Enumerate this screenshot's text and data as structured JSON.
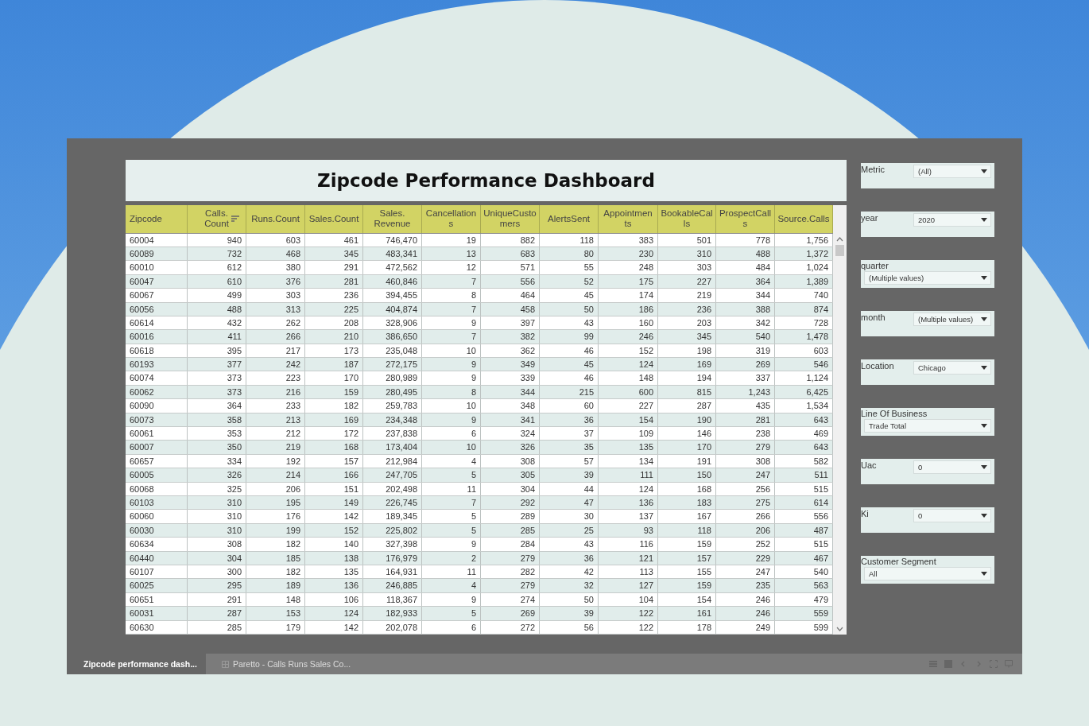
{
  "dashboard": {
    "title": "Zipcode Performance Dashboard"
  },
  "table": {
    "columns": [
      {
        "label_lines": [
          "Zipcode"
        ],
        "kind": "text",
        "sorted": false
      },
      {
        "label_lines": [
          "Calls.",
          "Count"
        ],
        "kind": "number",
        "sorted": true
      },
      {
        "label_lines": [
          "Runs.Count"
        ],
        "kind": "number",
        "sorted": false
      },
      {
        "label_lines": [
          "Sales.Count"
        ],
        "kind": "number",
        "sorted": false
      },
      {
        "label_lines": [
          "Sales.",
          "Revenue"
        ],
        "kind": "number",
        "sorted": false
      },
      {
        "label_lines": [
          "Cancellation",
          "s"
        ],
        "kind": "number",
        "sorted": false
      },
      {
        "label_lines": [
          "UniqueCusto",
          "mers"
        ],
        "kind": "number",
        "sorted": false
      },
      {
        "label_lines": [
          "AlertsSent"
        ],
        "kind": "number",
        "sorted": false
      },
      {
        "label_lines": [
          "Appointmen",
          "ts"
        ],
        "kind": "number",
        "sorted": false
      },
      {
        "label_lines": [
          "BookableCal",
          "ls"
        ],
        "kind": "number",
        "sorted": false
      },
      {
        "label_lines": [
          "ProspectCall",
          "s"
        ],
        "kind": "number",
        "sorted": false
      },
      {
        "label_lines": [
          "Source.Calls"
        ],
        "kind": "number",
        "sorted": false
      }
    ],
    "rows": [
      [
        "60004",
        "940",
        "603",
        "461",
        "746,470",
        "19",
        "882",
        "118",
        "383",
        "501",
        "778",
        "1,756"
      ],
      [
        "60089",
        "732",
        "468",
        "345",
        "483,341",
        "13",
        "683",
        "80",
        "230",
        "310",
        "488",
        "1,372"
      ],
      [
        "60010",
        "612",
        "380",
        "291",
        "472,562",
        "12",
        "571",
        "55",
        "248",
        "303",
        "484",
        "1,024"
      ],
      [
        "60047",
        "610",
        "376",
        "281",
        "460,846",
        "7",
        "556",
        "52",
        "175",
        "227",
        "364",
        "1,389"
      ],
      [
        "60067",
        "499",
        "303",
        "236",
        "394,455",
        "8",
        "464",
        "45",
        "174",
        "219",
        "344",
        "740"
      ],
      [
        "60056",
        "488",
        "313",
        "225",
        "404,874",
        "7",
        "458",
        "50",
        "186",
        "236",
        "388",
        "874"
      ],
      [
        "60614",
        "432",
        "262",
        "208",
        "328,906",
        "9",
        "397",
        "43",
        "160",
        "203",
        "342",
        "728"
      ],
      [
        "60016",
        "411",
        "266",
        "210",
        "386,650",
        "7",
        "382",
        "99",
        "246",
        "345",
        "540",
        "1,478"
      ],
      [
        "60618",
        "395",
        "217",
        "173",
        "235,048",
        "10",
        "362",
        "46",
        "152",
        "198",
        "319",
        "603"
      ],
      [
        "60193",
        "377",
        "242",
        "187",
        "272,175",
        "9",
        "349",
        "45",
        "124",
        "169",
        "269",
        "546"
      ],
      [
        "60074",
        "373",
        "223",
        "170",
        "280,989",
        "9",
        "339",
        "46",
        "148",
        "194",
        "337",
        "1,124"
      ],
      [
        "60062",
        "373",
        "216",
        "159",
        "280,495",
        "8",
        "344",
        "215",
        "600",
        "815",
        "1,243",
        "6,425"
      ],
      [
        "60090",
        "364",
        "233",
        "182",
        "259,783",
        "10",
        "348",
        "60",
        "227",
        "287",
        "435",
        "1,534"
      ],
      [
        "60073",
        "358",
        "213",
        "169",
        "234,348",
        "9",
        "341",
        "36",
        "154",
        "190",
        "281",
        "643"
      ],
      [
        "60061",
        "353",
        "212",
        "172",
        "237,838",
        "6",
        "324",
        "37",
        "109",
        "146",
        "238",
        "469"
      ],
      [
        "60007",
        "350",
        "219",
        "168",
        "173,404",
        "10",
        "326",
        "35",
        "135",
        "170",
        "279",
        "643"
      ],
      [
        "60657",
        "334",
        "192",
        "157",
        "212,984",
        "4",
        "308",
        "57",
        "134",
        "191",
        "308",
        "582"
      ],
      [
        "60005",
        "326",
        "214",
        "166",
        "247,705",
        "5",
        "305",
        "39",
        "111",
        "150",
        "247",
        "511"
      ],
      [
        "60068",
        "325",
        "206",
        "151",
        "202,498",
        "11",
        "304",
        "44",
        "124",
        "168",
        "256",
        "515"
      ],
      [
        "60103",
        "310",
        "195",
        "149",
        "226,745",
        "7",
        "292",
        "47",
        "136",
        "183",
        "275",
        "614"
      ],
      [
        "60060",
        "310",
        "176",
        "142",
        "189,345",
        "5",
        "289",
        "30",
        "137",
        "167",
        "266",
        "556"
      ],
      [
        "60030",
        "310",
        "199",
        "152",
        "225,802",
        "5",
        "285",
        "25",
        "93",
        "118",
        "206",
        "487"
      ],
      [
        "60634",
        "308",
        "182",
        "140",
        "327,398",
        "9",
        "284",
        "43",
        "116",
        "159",
        "252",
        "515"
      ],
      [
        "60440",
        "304",
        "185",
        "138",
        "176,979",
        "2",
        "279",
        "36",
        "121",
        "157",
        "229",
        "467"
      ],
      [
        "60107",
        "300",
        "182",
        "135",
        "164,931",
        "11",
        "282",
        "42",
        "113",
        "155",
        "247",
        "540"
      ],
      [
        "60025",
        "295",
        "189",
        "136",
        "246,885",
        "4",
        "279",
        "32",
        "127",
        "159",
        "235",
        "563"
      ],
      [
        "60651",
        "291",
        "148",
        "106",
        "118,367",
        "9",
        "274",
        "50",
        "104",
        "154",
        "246",
        "479"
      ],
      [
        "60031",
        "287",
        "153",
        "124",
        "182,933",
        "5",
        "269",
        "39",
        "122",
        "161",
        "246",
        "559"
      ],
      [
        "60630",
        "285",
        "179",
        "142",
        "202,078",
        "6",
        "272",
        "56",
        "122",
        "178",
        "249",
        "599"
      ]
    ]
  },
  "filters": [
    {
      "label": "Metric",
      "value": "(All)",
      "kind": "inline"
    },
    {
      "label": "year",
      "value": "2020",
      "kind": "inline"
    },
    {
      "label": "quarter",
      "value": "(Multiple values)",
      "kind": "stacked"
    },
    {
      "label": "month",
      "value": "(Multiple values)",
      "kind": "inline"
    },
    {
      "label": "Location",
      "value": "Chicago",
      "kind": "inline"
    },
    {
      "label": "Line Of Business",
      "value": "Trade Total",
      "kind": "stacked"
    },
    {
      "label": "Uac",
      "value": "0",
      "kind": "inline"
    },
    {
      "label": "Ki",
      "value": "0",
      "kind": "inline"
    },
    {
      "label": "Customer Segment",
      "value": "All",
      "kind": "stacked"
    }
  ],
  "sheet_tabs": [
    {
      "label": "Zipcode performance dash...",
      "kind": "dashboard",
      "selected": true
    },
    {
      "label": "Paretto - Calls Runs Sales Co...",
      "kind": "sheet",
      "selected": false
    }
  ]
}
